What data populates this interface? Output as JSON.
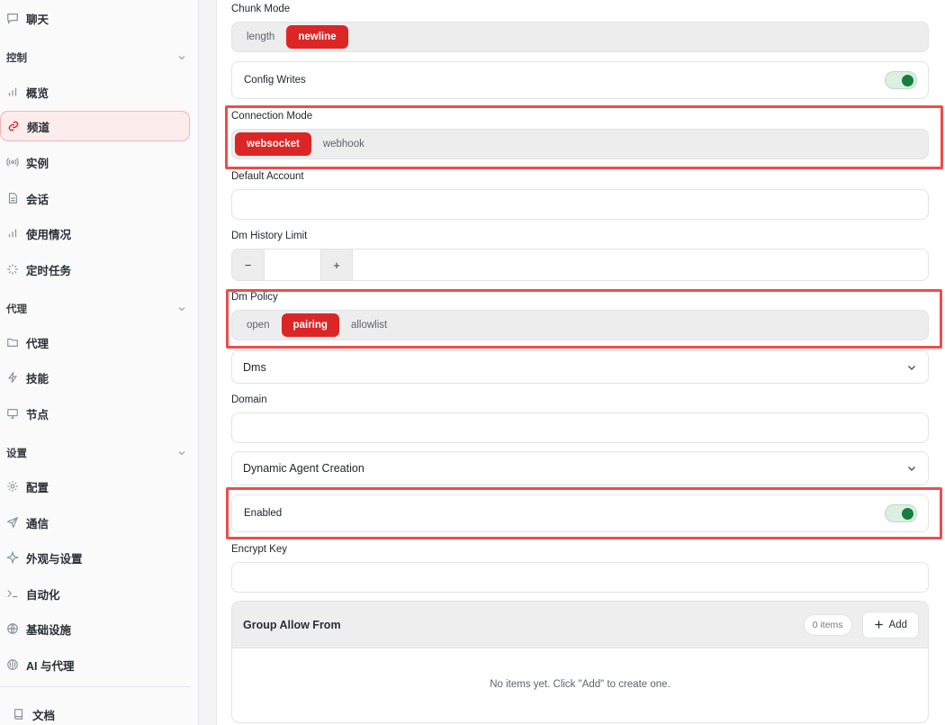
{
  "sidebar": {
    "chat": "聊天",
    "sections": [
      {
        "label": "控制",
        "items": [
          "概览",
          "频道",
          "实例",
          "会话",
          "使用情况",
          "定时任务"
        ]
      },
      {
        "label": "代理",
        "items": [
          "代理",
          "技能",
          "节点"
        ]
      },
      {
        "label": "设置",
        "items": [
          "配置",
          "通信",
          "外观与设置",
          "自动化",
          "基础设施",
          "AI 与代理"
        ]
      }
    ],
    "docs": "文档",
    "active_item": "频道"
  },
  "main": {
    "chunk_mode": {
      "label": "Chunk Mode",
      "options": [
        "length",
        "newline"
      ],
      "selected": "newline"
    },
    "config_writes": {
      "label": "Config Writes",
      "enabled": true
    },
    "connection_mode": {
      "label": "Connection Mode",
      "options": [
        "websocket",
        "webhook"
      ],
      "selected": "websocket"
    },
    "default_account": {
      "label": "Default Account",
      "value": ""
    },
    "dm_history_limit": {
      "label": "Dm History Limit",
      "minus": "−",
      "plus": "+",
      "value": ""
    },
    "dm_policy": {
      "label": "Dm Policy",
      "options": [
        "open",
        "pairing",
        "allowlist"
      ],
      "selected": "pairing"
    },
    "dms": {
      "label": "Dms"
    },
    "domain": {
      "label": "Domain",
      "value": ""
    },
    "dynamic_agent_creation": {
      "label": "Dynamic Agent Creation"
    },
    "enabled": {
      "label": "Enabled",
      "enabled": true
    },
    "encrypt_key": {
      "label": "Encrypt Key",
      "value": ""
    },
    "group_allow_from": {
      "title": "Group Allow From",
      "count": "0 items",
      "add_label": "Add",
      "empty": "No items yet. Click \"Add\" to create one."
    }
  },
  "colors": {
    "accent": "#dc2626",
    "toggle_on": "#15803d",
    "highlight": "#ef4c4c"
  }
}
